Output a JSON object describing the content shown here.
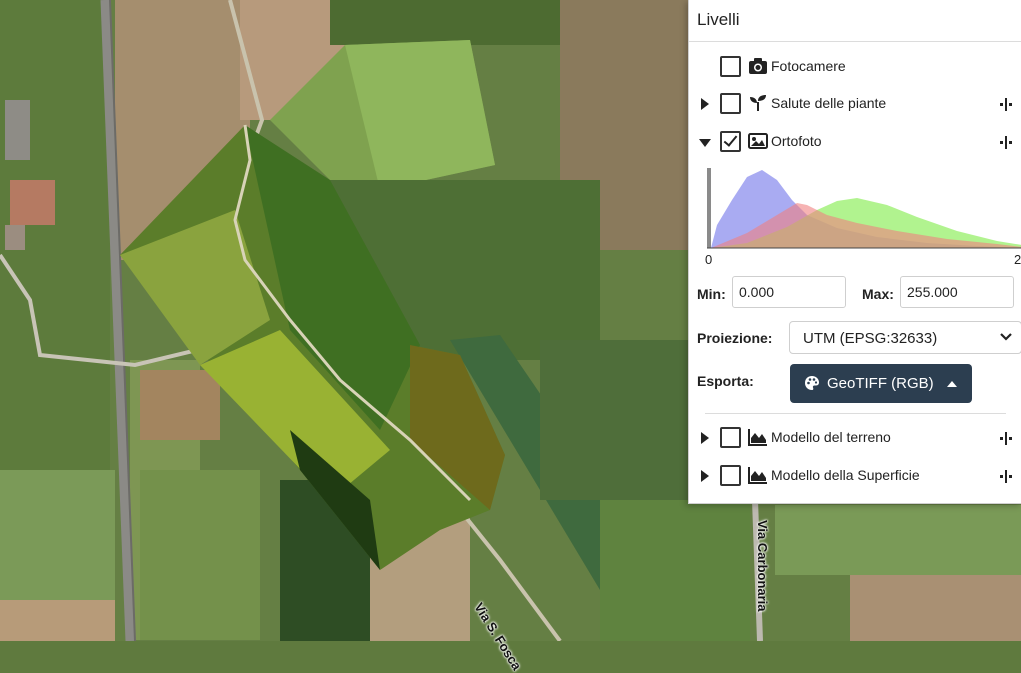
{
  "map": {
    "road_labels": [
      "Via S. Fosca",
      "Via Carbonaria"
    ]
  },
  "panel": {
    "title": "Livelli",
    "layers": [
      {
        "label": "Fotocamere",
        "checked": false,
        "icon": "camera-icon",
        "expandable": false
      },
      {
        "label": "Salute delle piante",
        "checked": false,
        "icon": "seedling-icon",
        "expandable": true,
        "expanded": false
      },
      {
        "label": "Ortofoto",
        "checked": true,
        "icon": "image-icon",
        "expandable": true,
        "expanded": true
      },
      {
        "label": "Modello del terreno",
        "checked": false,
        "icon": "area-chart-icon",
        "expandable": true,
        "expanded": false
      },
      {
        "label": "Modello della Superficie",
        "checked": false,
        "icon": "area-chart-icon",
        "expandable": true,
        "expanded": false
      }
    ],
    "histogram": {
      "axis_min_label": "0",
      "axis_max_label": "2",
      "colors": {
        "red": "#f08080",
        "green": "#90ee60",
        "blue": "#9a9cf0"
      }
    },
    "min_label": "Min:",
    "min_value": "0.000",
    "max_label": "Max:",
    "max_value": "255.000",
    "projection_label": "Proiezione:",
    "projection_value": "UTM (EPSG:32633)",
    "export_label": "Esporta:",
    "export_button": "GeoTIFF (RGB)"
  },
  "colors": {
    "export_button_bg": "#2c3e50"
  }
}
